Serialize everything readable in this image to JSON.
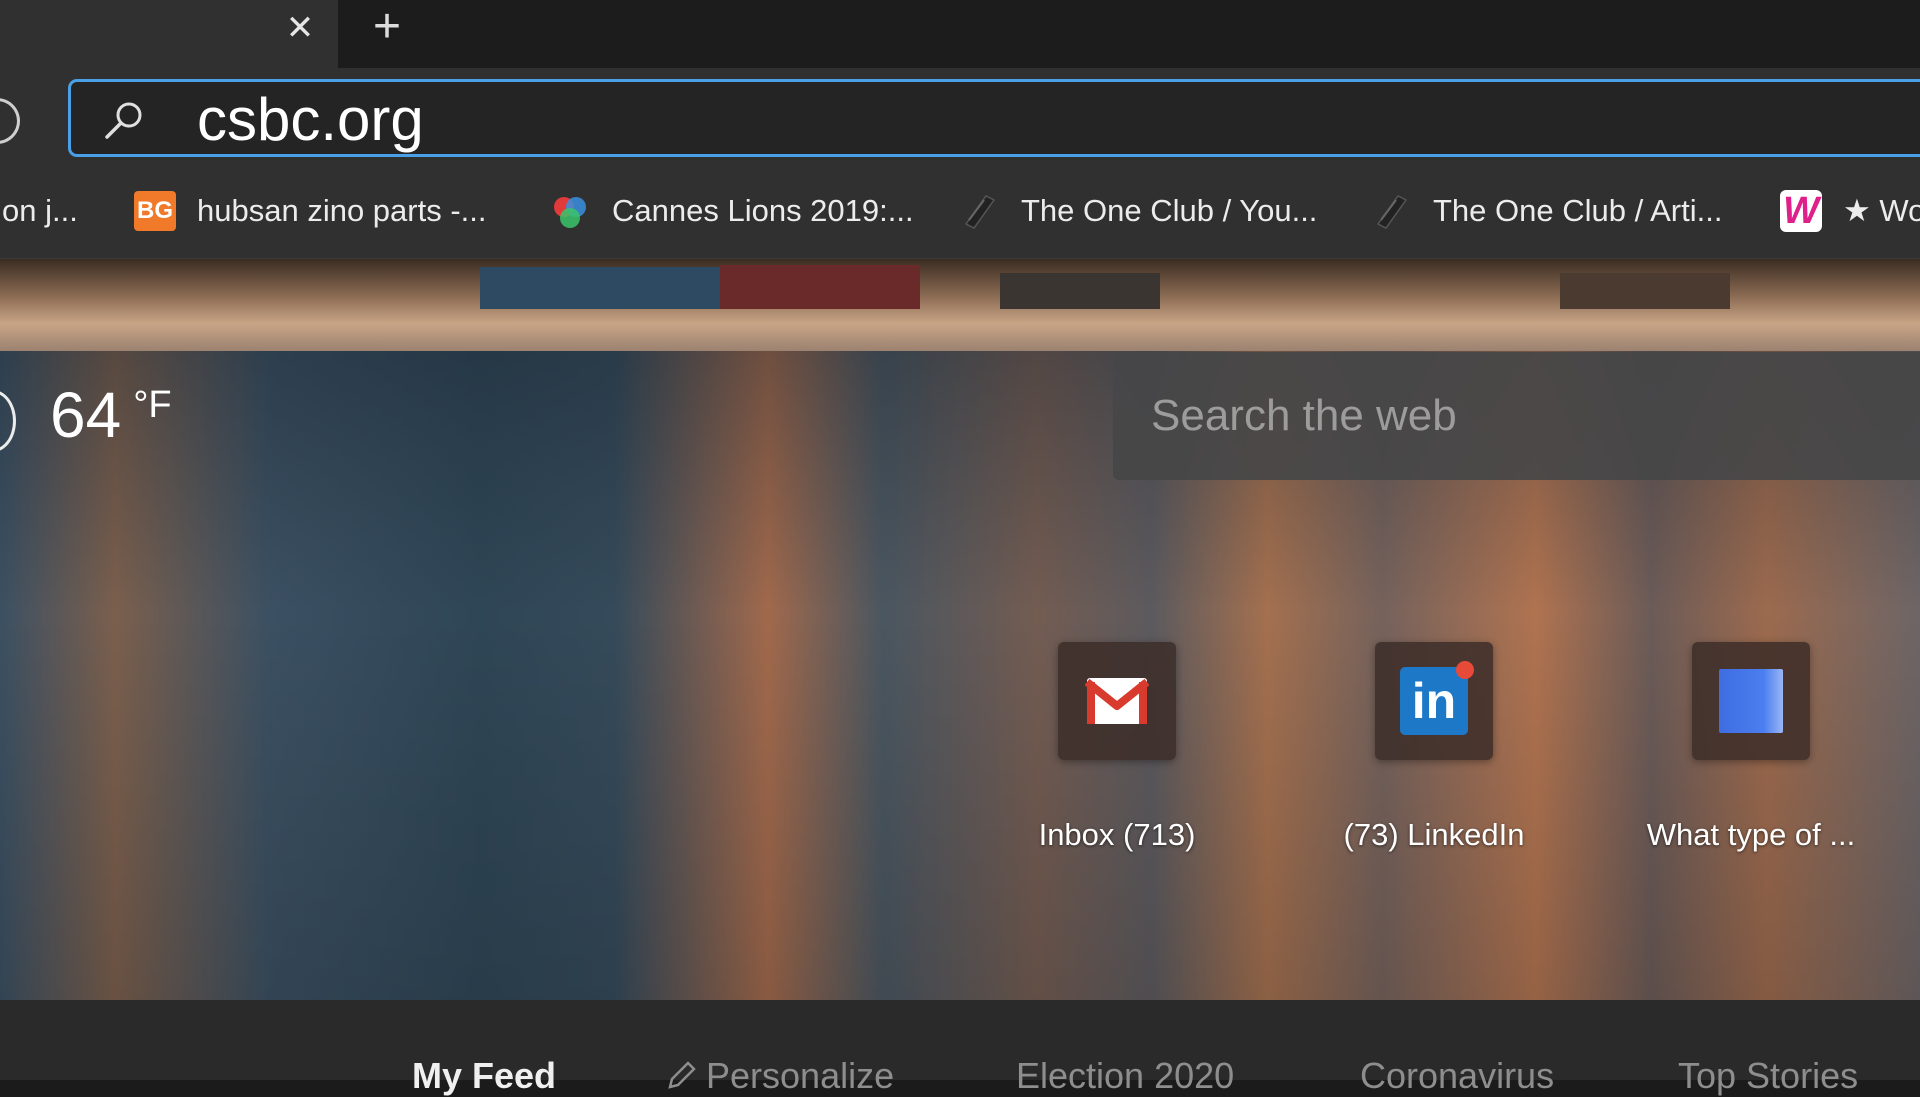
{
  "tabs": {
    "close_label": "✕",
    "new_tab_label": "+"
  },
  "address_bar": {
    "url": "csbc.org",
    "icon": "search-icon"
  },
  "favorites": [
    {
      "label": "on j...",
      "icon": ""
    },
    {
      "label": "hubsan zino parts -...",
      "icon": "bg-logo-icon",
      "badge_text": "BG"
    },
    {
      "label": "Cannes Lions 2019:...",
      "icon": "cannes-lions-icon"
    },
    {
      "label": "The One Club / You...",
      "icon": "one-club-icon"
    },
    {
      "label": "The One Club / Arti...",
      "icon": "one-club-icon"
    },
    {
      "label": "★ Wo",
      "icon": "w-logo-icon",
      "badge_text": "W"
    }
  ],
  "weather": {
    "temperature": "64",
    "unit": "°F"
  },
  "web_search": {
    "placeholder": "Search the web"
  },
  "quick_links": [
    {
      "label": "Inbox (713)",
      "icon": "gmail-icon"
    },
    {
      "label": "(73) LinkedIn",
      "icon": "linkedin-icon",
      "badge_text": "in"
    },
    {
      "label": "What type of ...",
      "icon": "blue-square-icon"
    }
  ],
  "feed_tabs": [
    {
      "label": "My Feed",
      "selected": true
    },
    {
      "label": "Personalize",
      "icon": "pencil-icon"
    },
    {
      "label": "Election 2020"
    },
    {
      "label": "Coronavirus"
    },
    {
      "label": "Top Stories"
    }
  ],
  "colors": {
    "accent_focus": "#4aa0e6",
    "toolbar_bg": "#303030",
    "tabstrip_bg": "#1c1c1c"
  }
}
